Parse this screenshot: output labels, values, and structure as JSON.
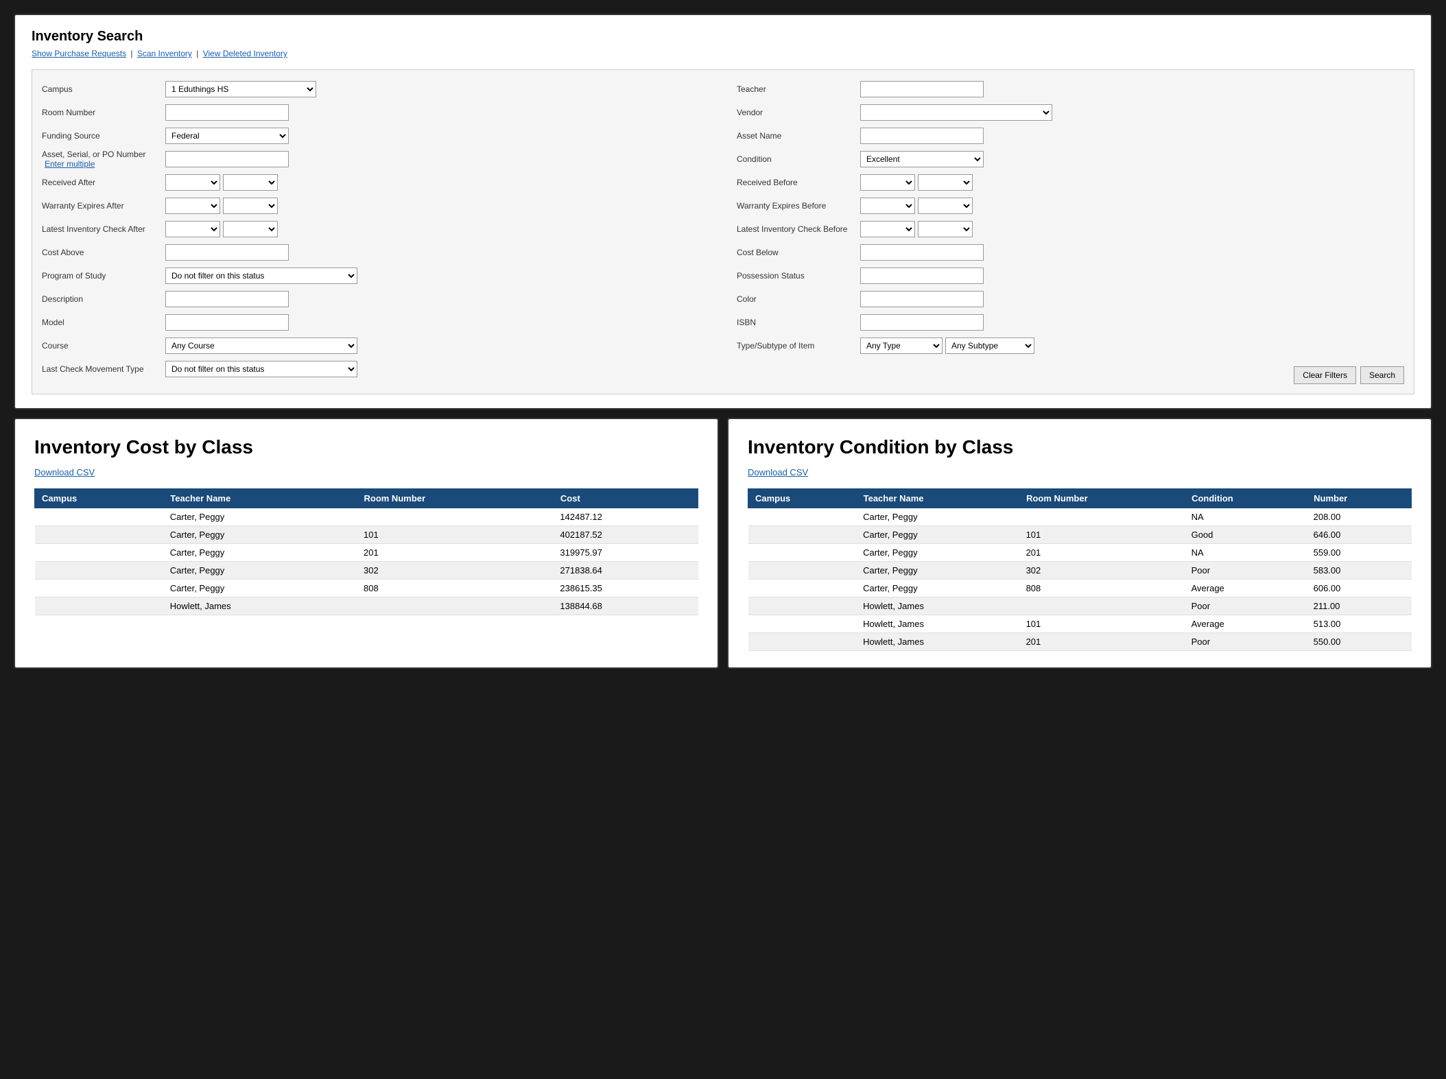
{
  "inventory_search": {
    "title": "Inventory Search",
    "nav": {
      "show_purchase_requests": "Show Purchase Requests",
      "scan_inventory": "Scan Inventory",
      "view_deleted_inventory": "View Deleted Inventory"
    },
    "form": {
      "campus_label": "Campus",
      "campus_value": "1 Eduthings HS",
      "room_number_label": "Room Number",
      "funding_source_label": "Funding Source",
      "funding_source_value": "Federal",
      "asset_serial_label": "Asset, Serial, or PO Number",
      "enter_multiple_link": "Enter multiple",
      "received_after_label": "Received After",
      "warranty_expires_after_label": "Warranty Expires After",
      "latest_inventory_check_after_label": "Latest Inventory Check After",
      "cost_above_label": "Cost Above",
      "program_of_study_label": "Program of Study",
      "program_of_study_value": "Do not filter on this status",
      "description_label": "Description",
      "model_label": "Model",
      "course_label": "Course",
      "course_value": "Any Course",
      "last_check_movement_type_label": "Last Check Movement Type",
      "last_check_movement_type_value": "Do not filter on this status",
      "teacher_label": "Teacher",
      "vendor_label": "Vendor",
      "asset_name_label": "Asset Name",
      "condition_label": "Condition",
      "condition_value": "Excellent",
      "received_before_label": "Received Before",
      "warranty_expires_before_label": "Warranty Expires Before",
      "latest_inventory_check_before_label": "Latest Inventory Check Before",
      "cost_below_label": "Cost Below",
      "possession_status_label": "Possession Status",
      "color_label": "Color",
      "isbn_label": "ISBN",
      "type_subtype_label": "Type/Subtype of Item",
      "type_value": "Any Type",
      "subtype_value": "Any Subtype",
      "clear_filters_btn": "Clear Filters",
      "search_btn": "Search"
    }
  },
  "inventory_cost": {
    "title": "Inventory Cost by Class",
    "download_link": "Download CSV",
    "columns": [
      "Campus",
      "Teacher Name",
      "Room Number",
      "Cost"
    ],
    "rows": [
      {
        "campus": "",
        "teacher": "Carter, Peggy",
        "room": "",
        "cost": "142487.12"
      },
      {
        "campus": "",
        "teacher": "Carter, Peggy",
        "room": "101",
        "cost": "402187.52"
      },
      {
        "campus": "",
        "teacher": "Carter, Peggy",
        "room": "201",
        "cost": "319975.97"
      },
      {
        "campus": "",
        "teacher": "Carter, Peggy",
        "room": "302",
        "cost": "271838.64"
      },
      {
        "campus": "",
        "teacher": "Carter, Peggy",
        "room": "808",
        "cost": "238615.35"
      },
      {
        "campus": "",
        "teacher": "Howlett, James",
        "room": "",
        "cost": "138844.68"
      }
    ]
  },
  "inventory_condition": {
    "title": "Inventory Condition by Class",
    "download_link": "Download CSV",
    "columns": [
      "Campus",
      "Teacher Name",
      "Room Number",
      "Condition",
      "Number"
    ],
    "rows": [
      {
        "campus": "",
        "teacher": "Carter, Peggy",
        "room": "",
        "condition": "NA",
        "number": "208.00"
      },
      {
        "campus": "",
        "teacher": "Carter, Peggy",
        "room": "101",
        "condition": "Good",
        "number": "646.00"
      },
      {
        "campus": "",
        "teacher": "Carter, Peggy",
        "room": "201",
        "condition": "NA",
        "number": "559.00"
      },
      {
        "campus": "",
        "teacher": "Carter, Peggy",
        "room": "302",
        "condition": "Poor",
        "number": "583.00"
      },
      {
        "campus": "",
        "teacher": "Carter, Peggy",
        "room": "808",
        "condition": "Average",
        "number": "606.00"
      },
      {
        "campus": "",
        "teacher": "Howlett, James",
        "room": "",
        "condition": "Poor",
        "number": "211.00"
      },
      {
        "campus": "",
        "teacher": "Howlett, James",
        "room": "101",
        "condition": "Average",
        "number": "513.00"
      },
      {
        "campus": "",
        "teacher": "Howlett, James",
        "room": "201",
        "condition": "Poor",
        "number": "550.00"
      }
    ]
  }
}
